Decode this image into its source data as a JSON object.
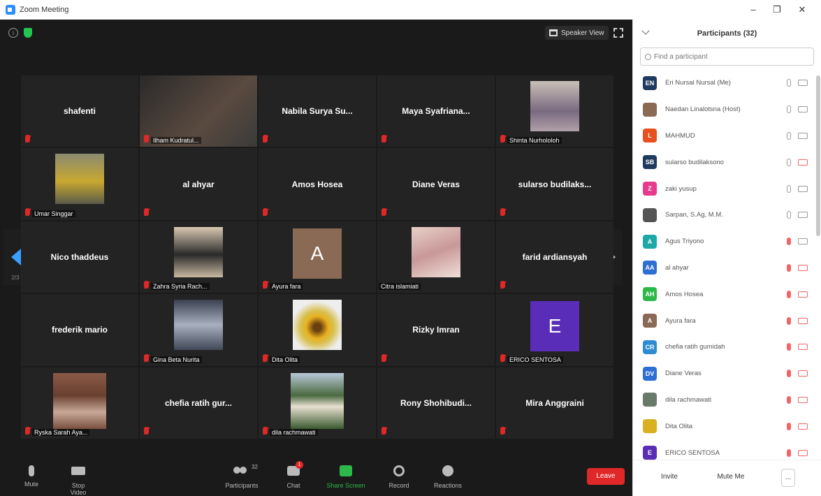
{
  "window": {
    "title": "Zoom Meeting",
    "minimize": "–",
    "restore": "❐",
    "close": "✕"
  },
  "top": {
    "view_label": "Speaker View"
  },
  "tiles": [
    {
      "name": "shafenti",
      "caption": ""
    },
    {
      "name": "",
      "caption": "Ilham Kudratul..."
    },
    {
      "name": "Nabila Surya Su...",
      "caption": ""
    },
    {
      "name": "Maya Syafriana...",
      "caption": ""
    },
    {
      "name": "",
      "caption": "Shinta Nurhololoh"
    },
    {
      "name": "",
      "caption": "Umar Singgar"
    },
    {
      "name": "al ahyar",
      "caption": ""
    },
    {
      "name": "Amos Hosea",
      "caption": ""
    },
    {
      "name": "Diane Veras",
      "caption": ""
    },
    {
      "name": "sularso budilaks...",
      "caption": ""
    },
    {
      "name": "Nico thaddeus",
      "caption": ""
    },
    {
      "name": "",
      "caption": "Zahra Syria Rach..."
    },
    {
      "name": "",
      "caption": "Ayura fara",
      "letter": "A"
    },
    {
      "name": "",
      "caption": "Citra islamiati"
    },
    {
      "name": "farid ardiansyah",
      "caption": ""
    },
    {
      "name": "frederik mario",
      "caption": ""
    },
    {
      "name": "",
      "caption": "Gina Beta Nurita"
    },
    {
      "name": "",
      "caption": "Dita Olita"
    },
    {
      "name": "Rizky Imran",
      "caption": ""
    },
    {
      "name": "",
      "caption": "ERICO SENTOSA",
      "letter": "E"
    },
    {
      "name": "",
      "caption": "Ryska Sarah Aya..."
    },
    {
      "name": "chefia ratih gur...",
      "caption": ""
    },
    {
      "name": "",
      "caption": "dila rachmawati"
    },
    {
      "name": "Rony Shohibudi...",
      "caption": ""
    },
    {
      "name": "Mira Anggraini",
      "caption": ""
    }
  ],
  "nav": {
    "page_left": "2/3",
    "page_right": "2/3"
  },
  "toolbar": {
    "mute": "Mute",
    "stop_video": "Stop Video",
    "participants": "Participants",
    "participants_count": "32",
    "chat": "Chat",
    "chat_badge": "1",
    "share_screen": "Share Screen",
    "record": "Record",
    "reactions": "Reactions",
    "leave": "Leave"
  },
  "panel": {
    "title": "Participants (32)",
    "search_placeholder": "Find a participant",
    "participants": [
      {
        "initials": "EN",
        "name": "Eri Nursal Nursal (Me)",
        "color": "#1f3a5f",
        "mic": "on",
        "cam": "on"
      },
      {
        "initials": "",
        "name": "Naedan Linalotsna (Host)",
        "color": "#8a6a55",
        "mic": "on",
        "cam": "on"
      },
      {
        "initials": "L",
        "name": "MAHMUD",
        "color": "#e8501f",
        "mic": "on",
        "cam": "on"
      },
      {
        "initials": "SB",
        "name": "sularso budilaksono",
        "color": "#1f3a5f",
        "mic": "on",
        "cam": "off"
      },
      {
        "initials": "Z",
        "name": "zaki yusup",
        "color": "#e83a8c",
        "mic": "on",
        "cam": "on"
      },
      {
        "initials": "",
        "name": "Sarpan, S.Ag, M.M.",
        "color": "#555555",
        "mic": "on",
        "cam": "on"
      },
      {
        "initials": "A",
        "name": "Agus Triyono",
        "color": "#1fa8a8",
        "mic": "off",
        "cam": "on"
      },
      {
        "initials": "AA",
        "name": "al ahyar",
        "color": "#2d6fd2",
        "mic": "off",
        "cam": "off"
      },
      {
        "initials": "AH",
        "name": "Amos Hosea",
        "color": "#2db84a",
        "mic": "off",
        "cam": "off"
      },
      {
        "initials": "A",
        "name": "Ayura fara",
        "color": "#8a6a55",
        "mic": "off",
        "cam": "off"
      },
      {
        "initials": "CR",
        "name": "chefia ratih gumidah",
        "color": "#2d8cd2",
        "mic": "off",
        "cam": "off"
      },
      {
        "initials": "DV",
        "name": "Diane Veras",
        "color": "#2d6fd2",
        "mic": "off",
        "cam": "off"
      },
      {
        "initials": "",
        "name": "dila rachmawati",
        "color": "#6a7a6a",
        "mic": "off",
        "cam": "off"
      },
      {
        "initials": "",
        "name": "Dita Olita",
        "color": "#d8b020",
        "mic": "off",
        "cam": "off"
      },
      {
        "initials": "E",
        "name": "ERICO SENTOSA",
        "color": "#5a2db8",
        "mic": "off",
        "cam": "off"
      }
    ],
    "invite": "Invite",
    "mute_me": "Mute Me",
    "more": "..."
  }
}
